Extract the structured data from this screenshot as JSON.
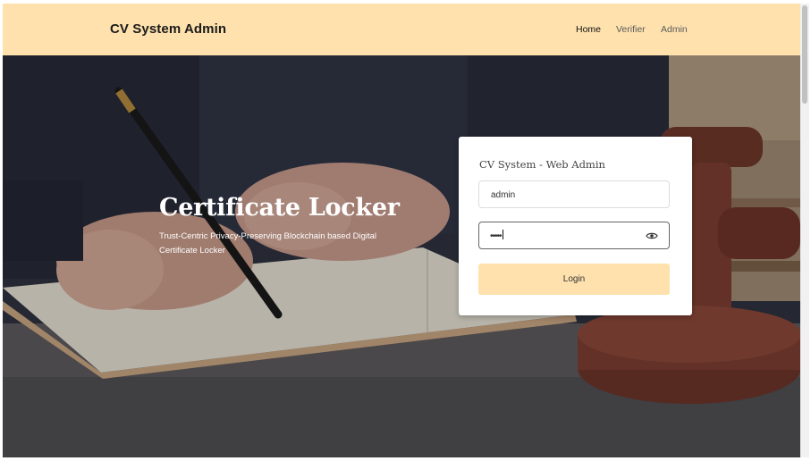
{
  "navbar": {
    "brand": "CV System Admin",
    "links": [
      {
        "label": "Home",
        "active": true
      },
      {
        "label": "Verifier",
        "active": false
      },
      {
        "label": "Admin",
        "active": false
      }
    ]
  },
  "hero": {
    "title": "Certificate Locker",
    "subtitle": "Trust-Centric Privacy-Preserving Blockchain based Digital Certificate Locker"
  },
  "login": {
    "title": "CV System - Web Admin",
    "username_value": "admin",
    "password_masked": "•••••",
    "button_label": "Login"
  },
  "colors": {
    "accent": "#fee1ad",
    "card": "#ffffff"
  },
  "icons": [
    "eye-icon"
  ]
}
